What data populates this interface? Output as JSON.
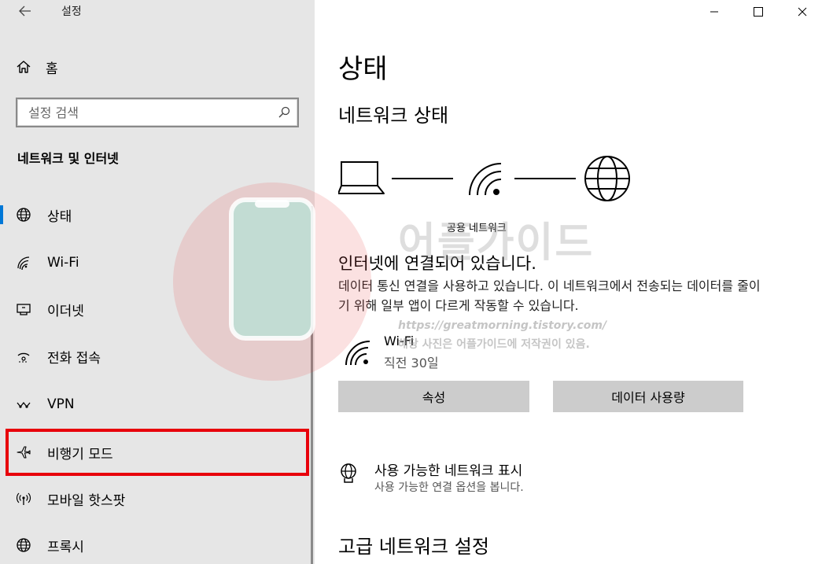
{
  "app": {
    "title": "설정"
  },
  "sidebar": {
    "home_label": "홈",
    "search_placeholder": "설정 검색",
    "section_heading": "네트워크 및 인터넷",
    "items": [
      {
        "label": "상태",
        "icon": "globe-status-icon",
        "active": true
      },
      {
        "label": "Wi-Fi",
        "icon": "wifi-icon"
      },
      {
        "label": "이더넷",
        "icon": "ethernet-icon"
      },
      {
        "label": "전화 접속",
        "icon": "dial-up-icon"
      },
      {
        "label": "VPN",
        "icon": "vpn-icon"
      },
      {
        "label": "비행기 모드",
        "icon": "airplane-icon",
        "highlighted": true
      },
      {
        "label": "모바일 핫스팟",
        "icon": "hotspot-icon"
      },
      {
        "label": "프록시",
        "icon": "proxy-globe-icon"
      }
    ]
  },
  "main": {
    "title": "상태",
    "subtitle": "네트워크 상태",
    "network_name": "공용 네트워크",
    "connection_title": "인터넷에 연결되어 있습니다.",
    "connection_description": "데이터 통신 연결을 사용하고 있습니다. 이 네트워크에서 전송되는 데이터를 줄이기 위해 일부 앱이 다르게 작동할 수 있습니다.",
    "wifi": {
      "name": "Wi-Fi",
      "usage": "직전 30일"
    },
    "buttons": {
      "properties": "속성",
      "data_usage": "데이터 사용량"
    },
    "available_networks": {
      "title": "사용 가능한 네트워크 표시",
      "subtitle": "사용 가능한 연결 옵션을 봅니다."
    },
    "advanced_heading": "고급 네트워크 설정"
  },
  "watermark": {
    "brand": "어플가이드",
    "url": "https://greatmorning.tistory.com/",
    "notice": "해당 사진은 어플가이드에 저작권이 있음."
  },
  "colors": {
    "sidebar_bg": "#e6e6e6",
    "accent": "#0078d7",
    "highlight": "#e8000b",
    "button_bg": "#cccccc"
  }
}
